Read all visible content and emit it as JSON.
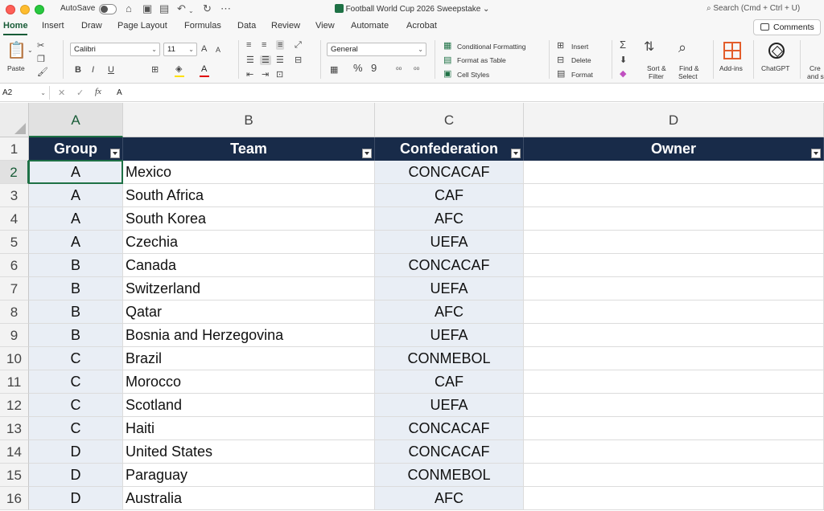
{
  "window": {
    "autosave_label": "AutoSave",
    "doc_title": "Football World Cup 2026 Sweepstake",
    "search_placeholder": "Search (Cmd + Ctrl + U)"
  },
  "menu": {
    "tabs": [
      "Home",
      "Insert",
      "Draw",
      "Page Layout",
      "Formulas",
      "Data",
      "Review",
      "View",
      "Automate",
      "Acrobat"
    ],
    "active_tab": "Home",
    "comments_label": "Comments"
  },
  "ribbon": {
    "paste_label": "Paste",
    "font_name": "Calibri",
    "font_size": "11",
    "number_format": "General",
    "conditional_formatting": "Conditional Formatting",
    "format_as_table": "Format as Table",
    "cell_styles": "Cell Styles",
    "insert": "Insert",
    "delete": "Delete",
    "format": "Format",
    "sort_filter_1": "Sort &",
    "sort_filter_2": "Filter",
    "find_select_1": "Find &",
    "find_select_2": "Select",
    "addins": "Add-ins",
    "chatgpt": "ChatGPT",
    "create_1": "Cre",
    "create_2": "and s",
    "bold": "B",
    "italic": "I",
    "underline": "U",
    "percent": "%",
    "comma": "9",
    "font_grow": "A",
    "font_shrink": "A"
  },
  "formula_bar": {
    "name_box": "A2",
    "fx": "fx",
    "value": "A"
  },
  "sheet": {
    "columns": [
      "A",
      "B",
      "C",
      "D"
    ],
    "selected_column": "A",
    "selected_row": "2",
    "header_row_number": "1",
    "headers": [
      "Group",
      "Team",
      "Confederation",
      "Owner"
    ],
    "rows": [
      {
        "num": "2",
        "group": "A",
        "team": "Mexico",
        "conf": "CONCACAF",
        "owner": ""
      },
      {
        "num": "3",
        "group": "A",
        "team": "South Africa",
        "conf": "CAF",
        "owner": ""
      },
      {
        "num": "4",
        "group": "A",
        "team": "South Korea",
        "conf": "AFC",
        "owner": ""
      },
      {
        "num": "5",
        "group": "A",
        "team": "Czechia",
        "conf": "UEFA",
        "owner": ""
      },
      {
        "num": "6",
        "group": "B",
        "team": "Canada",
        "conf": "CONCACAF",
        "owner": ""
      },
      {
        "num": "7",
        "group": "B",
        "team": "Switzerland",
        "conf": "UEFA",
        "owner": ""
      },
      {
        "num": "8",
        "group": "B",
        "team": "Qatar",
        "conf": "AFC",
        "owner": ""
      },
      {
        "num": "9",
        "group": "B",
        "team": "Bosnia and Herzegovina",
        "conf": "UEFA",
        "owner": ""
      },
      {
        "num": "10",
        "group": "C",
        "team": "Brazil",
        "conf": "CONMEBOL",
        "owner": ""
      },
      {
        "num": "11",
        "group": "C",
        "team": "Morocco",
        "conf": "CAF",
        "owner": ""
      },
      {
        "num": "12",
        "group": "C",
        "team": "Scotland",
        "conf": "UEFA",
        "owner": ""
      },
      {
        "num": "13",
        "group": "C",
        "team": "Haiti",
        "conf": "CONCACAF",
        "owner": ""
      },
      {
        "num": "14",
        "group": "D",
        "team": "United States",
        "conf": "CONCACAF",
        "owner": ""
      },
      {
        "num": "15",
        "group": "D",
        "team": "Paraguay",
        "conf": "CONMEBOL",
        "owner": ""
      },
      {
        "num": "16",
        "group": "D",
        "team": "Australia",
        "conf": "AFC",
        "owner": ""
      }
    ]
  },
  "colors": {
    "table_header_bg": "#182b49",
    "excel_green": "#1e7145",
    "shaded_column_bg": "#e9eef5"
  }
}
